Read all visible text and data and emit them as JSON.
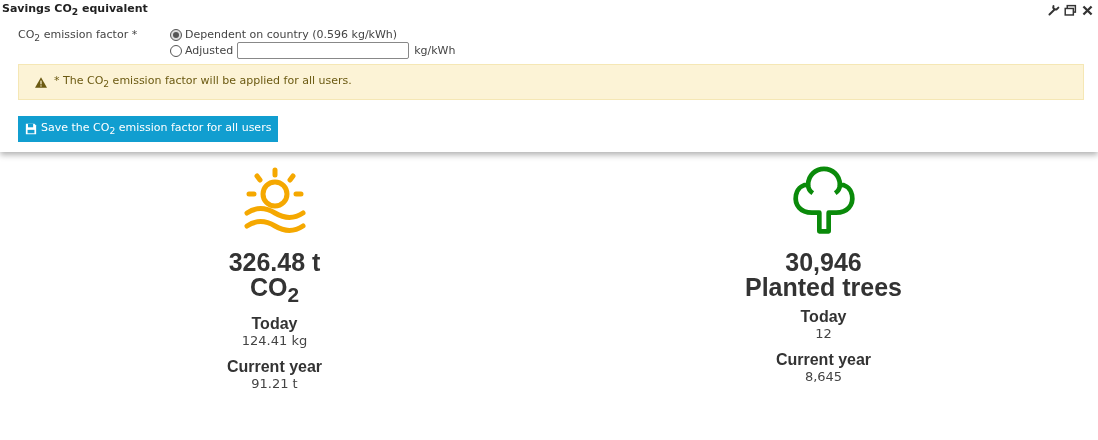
{
  "panel": {
    "title": "Savings CO$_{2}$ equivalent",
    "tools": [
      {
        "kind": "wrench"
      },
      {
        "kind": "restore"
      },
      {
        "kind": "close"
      }
    ],
    "field": {
      "label": "CO$_{2}$ emission factor *",
      "options": [
        {
          "label": "Dependent on country (0.596 kg/kWh)",
          "selected": true
        },
        {
          "label": "Adjusted",
          "selected": false,
          "input": {
            "unit": "kg/kWh"
          }
        }
      ]
    },
    "notice": "* The CO$_{2}$ emission factor will be applied for all users.",
    "save_button": "Save the CO$_{2}$ emission factor for all users"
  },
  "stats": [
    {
      "kind": "sun",
      "value": "326.48 t",
      "unit": "CO$_{2}$",
      "today_label": "Today",
      "today": "124.41 kg",
      "year_label": "Current year",
      "year": "91.21 t"
    },
    {
      "kind": "tree",
      "value": "30,946",
      "unit": "Planted trees",
      "today_label": "Today",
      "today": "12",
      "year_label": "Current year",
      "year": "8,645"
    }
  ]
}
